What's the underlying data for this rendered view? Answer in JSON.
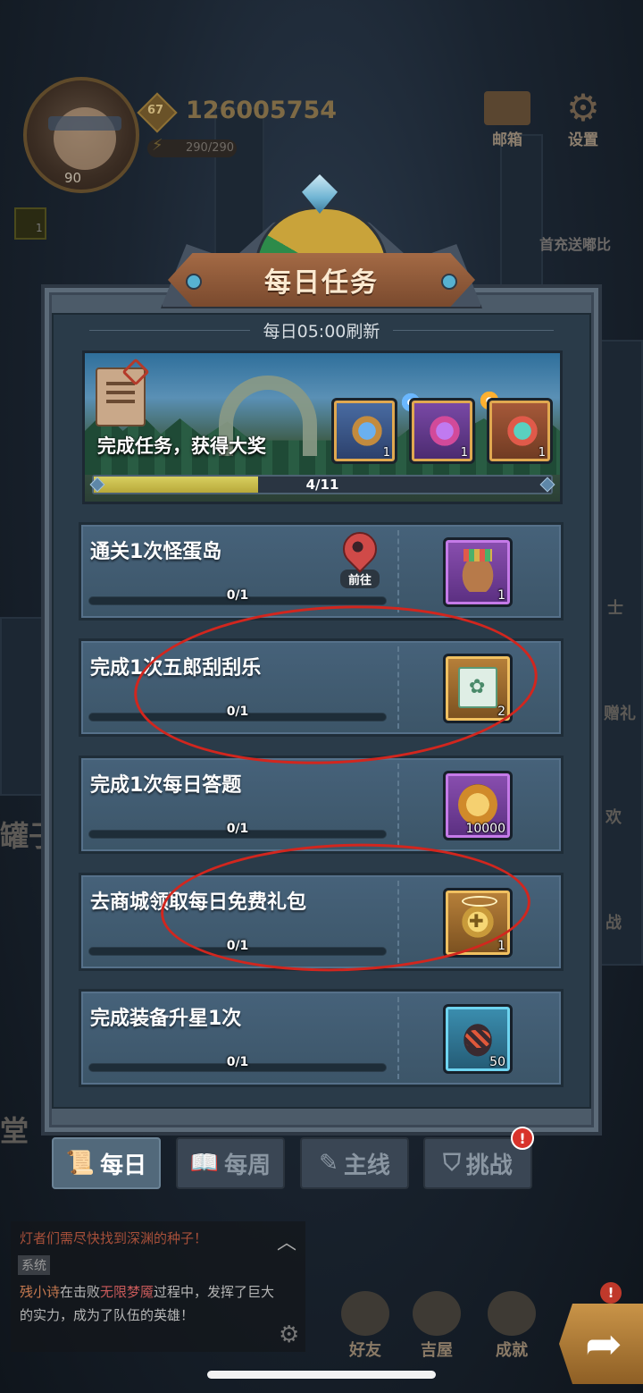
{
  "hud": {
    "avatar_level": "90",
    "player_level_badge": "67",
    "gold": "126005754",
    "energy": "290/290",
    "buff_count": "1",
    "mail_label": "邮箱",
    "settings_label": "设置",
    "promo_text": "首充送嘟比",
    "side_labels": [
      "士",
      "赠礼",
      "欢",
      "战"
    ],
    "side_big": [
      "罐子",
      "堂"
    ]
  },
  "dialog": {
    "title": "每日任务",
    "refresh_text": "每日05:00刷新",
    "banner": {
      "text": "完成任务，获得大奖",
      "progress_text": "4/11",
      "progress_fraction": 0.36,
      "chests": [
        {
          "icon": "blue-chest-icon",
          "count": "1"
        },
        {
          "icon": "purple-chest-icon",
          "count": "1"
        },
        {
          "icon": "red-chest-icon",
          "count": "1"
        }
      ]
    },
    "goto_label": "前往",
    "tasks": [
      {
        "name": "通关1次怪蛋岛",
        "progress": "0/1",
        "reward_icon": "item-bag-icon",
        "reward_count": "1",
        "has_goto": true
      },
      {
        "name": "完成1次五郎刮刮乐",
        "progress": "0/1",
        "reward_icon": "scratch-ticket-icon",
        "reward_count": "2",
        "has_goto": false
      },
      {
        "name": "完成1次每日答题",
        "progress": "0/1",
        "reward_icon": "gold-coin-icon",
        "reward_count": "10000",
        "has_goto": false
      },
      {
        "name": "去商城领取每日免费礼包",
        "progress": "0/1",
        "reward_icon": "halo-wings-icon",
        "reward_count": "1",
        "has_goto": false
      },
      {
        "name": "完成装备升星1次",
        "progress": "0/1",
        "reward_icon": "magma-ore-icon",
        "reward_count": "50",
        "has_goto": false
      }
    ]
  },
  "tabs": [
    {
      "label": "每日",
      "icon": "scroll-icon",
      "active": true
    },
    {
      "label": "每周",
      "icon": "book-icon",
      "active": false
    },
    {
      "label": "主线",
      "icon": "quill-icon",
      "active": false
    },
    {
      "label": "挑战",
      "icon": "banner-icon",
      "active": false,
      "alert": "!"
    }
  ],
  "chat": {
    "line1": "灯者们需尽快找到深渊的种子！",
    "tag": "系统",
    "msg_name": "残小诗",
    "msg_part1": "在击败",
    "msg_boss": "无限梦魇",
    "msg_part2": "过程中，发挥了巨大的实力，成为了队伍的英雄！"
  },
  "footer": {
    "friends": "好友",
    "house": "吉屋",
    "achievements": "成就",
    "alert": "!"
  },
  "colors": {
    "annotation": "#d2261e",
    "banner_progress": "#d8cf60",
    "active_tab": "#52697b"
  }
}
